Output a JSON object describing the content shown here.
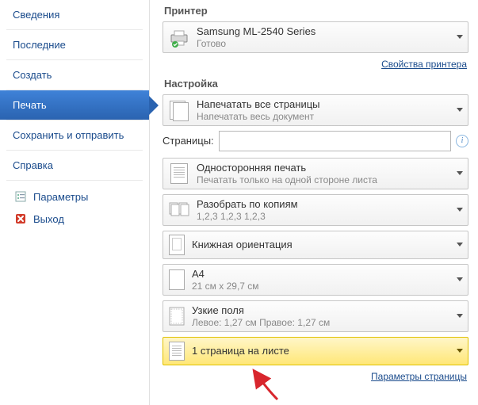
{
  "sidebar": {
    "items": [
      {
        "label": "Сведения"
      },
      {
        "label": "Последние"
      },
      {
        "label": "Создать"
      },
      {
        "label": "Печать"
      },
      {
        "label": "Сохранить и отправить"
      },
      {
        "label": "Справка"
      }
    ],
    "sub": [
      {
        "icon": "options-icon",
        "label": "Параметры"
      },
      {
        "icon": "exit-icon",
        "label": "Выход"
      }
    ]
  },
  "printer": {
    "heading": "Принтер",
    "name": "Samsung ML-2540 Series",
    "status": "Готово",
    "properties_link": "Свойства принтера"
  },
  "settings": {
    "heading": "Настройка",
    "print_what": {
      "title": "Напечатать все страницы",
      "sub": "Напечатать весь документ"
    },
    "pages_label": "Страницы:",
    "pages_value": "",
    "sides": {
      "title": "Односторонняя печать",
      "sub": "Печатать только на одной стороне листа"
    },
    "collate": {
      "title": "Разобрать по копиям",
      "sub": "1,2,3   1,2,3   1,2,3"
    },
    "orientation": {
      "title": "Книжная ориентация"
    },
    "paper": {
      "title": "A4",
      "sub": "21 см x 29,7 см"
    },
    "margins": {
      "title": "Узкие поля",
      "sub": "Левое: 1,27 см   Правое: 1,27 см"
    },
    "per_sheet": {
      "title": "1 страница на листе"
    },
    "page_setup_link": "Параметры страницы"
  }
}
